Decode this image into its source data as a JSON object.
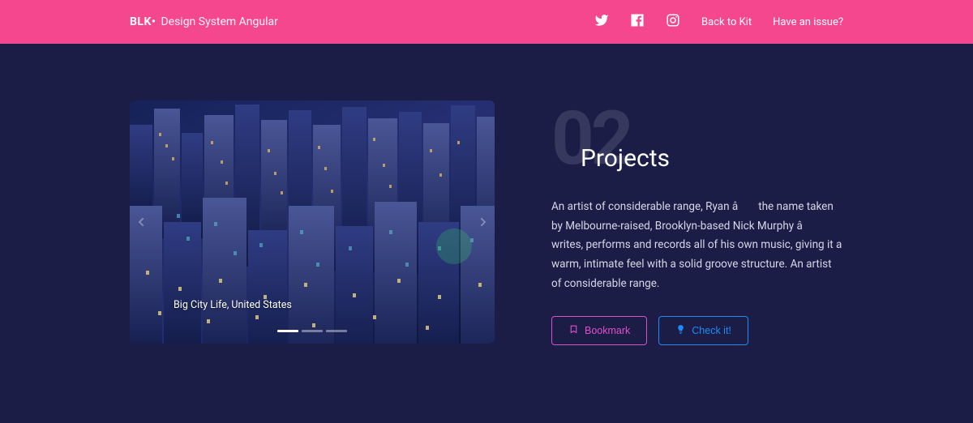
{
  "nav": {
    "brand_bold": "BLK•",
    "brand_rest": "Design System Angular",
    "links": {
      "back": "Back to Kit",
      "issue": "Have an issue?"
    }
  },
  "section": {
    "number": "02",
    "title": "Projects",
    "description": "An artist of considerable range, Ryan â the name taken by Melbourne-raised, Brooklyn-based Nick Murphy â writes, performs and records all of his own music, giving it a warm, intimate feel with a solid groove structure. An artist of considerable range.",
    "buttons": {
      "bookmark": "Bookmark",
      "check": "Check it!"
    },
    "caption": "Big City Life, United States"
  }
}
